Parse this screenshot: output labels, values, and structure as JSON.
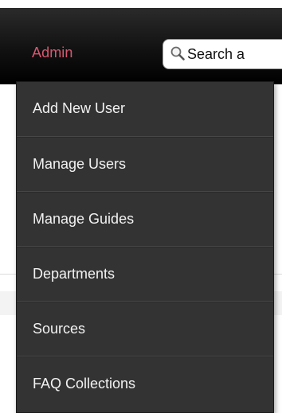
{
  "nav": {
    "admin_label": "Admin",
    "search": {
      "value": "Search a",
      "icon": "search-icon"
    }
  },
  "admin_menu": {
    "items": [
      {
        "label": "Add New User"
      },
      {
        "label": "Manage Users"
      },
      {
        "label": "Manage Guides"
      },
      {
        "label": "Departments"
      },
      {
        "label": "Sources"
      },
      {
        "label": "FAQ Collections"
      }
    ]
  },
  "colors": {
    "admin_link": "#d8576f",
    "menu_background": "#333333",
    "menu_text": "#f2f2f2",
    "topbar": "#111111"
  }
}
